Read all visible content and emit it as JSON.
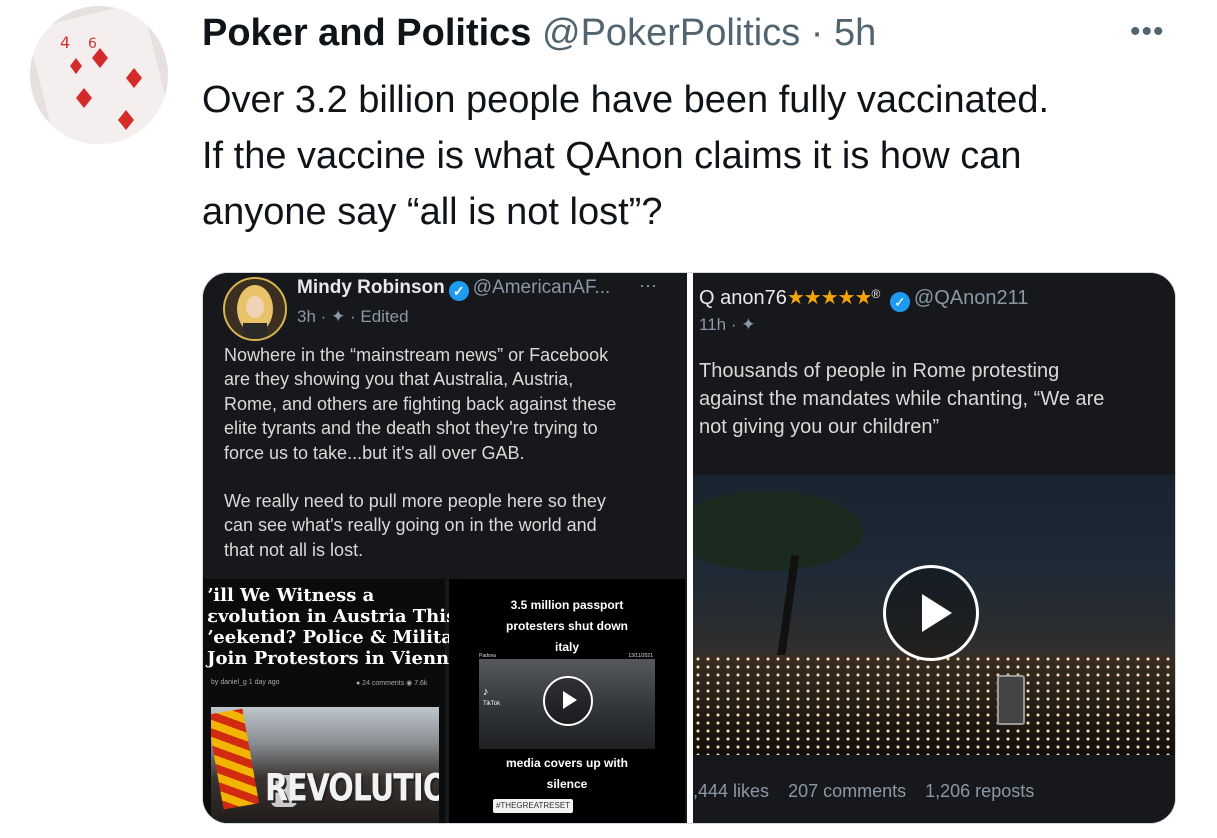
{
  "tweet": {
    "author_name": "Poker and Politics",
    "author_handle": "@PokerPolitics",
    "time": "· 5h",
    "more": "•••",
    "text_lines": [
      "Over 3.2 billion people have been fully vaccinated.",
      "If the vaccine is what QAnon claims it is how can",
      "anyone say “all is not lost”?"
    ]
  },
  "media_left": {
    "name": "Mindy Robinson",
    "handle": "@AmericanAF...",
    "meta": "3h · ✦ · Edited",
    "dots": "···",
    "body_p1": [
      "Nowhere in the “mainstream news” or Facebook",
      "are they showing you that Australia, Austria,",
      "Rome, and others are fighting back against these",
      "elite tyrants and the death shot they're trying to",
      "force us to take...but it's all over GAB."
    ],
    "body_p2": [
      "We really need to pull more people here so they",
      "can see what's really going on in the world and",
      "that not all is lost."
    ],
    "article_title": [
      "ʼill We Witness a",
      "ɛvolution in Austria This",
      "ʼeekend? Police & Military",
      " Join Protestors in Vienna"
    ],
    "article_author": "by daniel_g  1 day ago",
    "article_stats": "● 24 comments   ◉ 7.6k",
    "article_image_text": "REVOLUTION",
    "tiktok_top": [
      "3.5 million passport",
      "protesters shut down",
      "italy"
    ],
    "tiktok_location": "Padova",
    "tiktok_date": "13/11/2021",
    "tiktok_logo": "TikTok",
    "tiktok_bottom": [
      "media covers up with",
      "silence"
    ],
    "tiktok_tag": "#THEGREATRESET"
  },
  "media_right": {
    "name": "Q anon76",
    "stars": "★★★★★",
    "registered": "®",
    "handle": "@QAnon211",
    "meta": "11h · ✦",
    "body": [
      "Thousands of people in Rome protesting",
      "against the mandates while chanting, “We are",
      "not giving you our children”"
    ],
    "likes": ",444 likes",
    "comments": "207 comments",
    "reposts": "1,206 reposts"
  }
}
